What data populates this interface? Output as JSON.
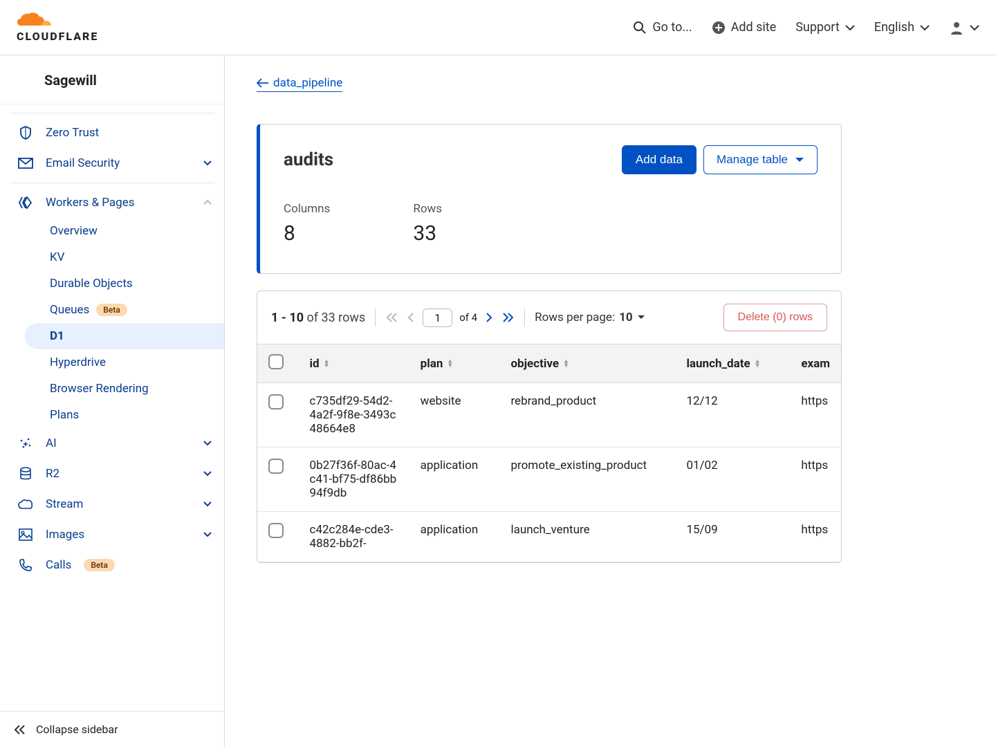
{
  "header": {
    "goto": "Go to...",
    "add_site": "Add site",
    "support": "Support",
    "language": "English"
  },
  "sidebar": {
    "account": "Sagewill",
    "zero_trust": "Zero Trust",
    "email_security": "Email Security",
    "workers_pages": "Workers & Pages",
    "sub": {
      "overview": "Overview",
      "kv": "KV",
      "durable": "Durable Objects",
      "queues": "Queues",
      "queues_badge": "Beta",
      "d1": "D1",
      "hyperdrive": "Hyperdrive",
      "browser": "Browser Rendering",
      "plans": "Plans"
    },
    "ai": "AI",
    "r2": "R2",
    "stream": "Stream",
    "images": "Images",
    "calls": "Calls",
    "calls_badge": "Beta",
    "collapse": "Collapse sidebar"
  },
  "main": {
    "back": " data_pipeline",
    "title": "audits",
    "add_data": "Add data",
    "manage_table": "Manage table",
    "columns_label": "Columns",
    "columns_value": "8",
    "rows_label": "Rows",
    "rows_value": "33"
  },
  "toolbar": {
    "range_strong": "1 - 10",
    "range_rest": " of 33 rows",
    "page_current": "1",
    "page_total": "of 4",
    "rpp_label": "Rows per page: ",
    "rpp_value": "10",
    "delete": "Delete (0) rows"
  },
  "table": {
    "headers": {
      "id": "id",
      "plan": "plan",
      "objective": "objective",
      "launch_date": "launch_date",
      "example": "exam"
    },
    "rows": [
      {
        "id": "c735df29-54d2-4a2f-9f8e-3493c48664e8",
        "plan": "website",
        "objective": "rebrand_product",
        "launch_date": "12/12",
        "example": "https"
      },
      {
        "id": "0b27f36f-80ac-4c41-bf75-df86bb94f9db",
        "plan": "application",
        "objective": "promote_existing_product",
        "launch_date": "01/02",
        "example": "https"
      },
      {
        "id": "c42c284e-cde3-4882-bb2f-",
        "plan": "application",
        "objective": "launch_venture",
        "launch_date": "15/09",
        "example": "https"
      }
    ]
  }
}
